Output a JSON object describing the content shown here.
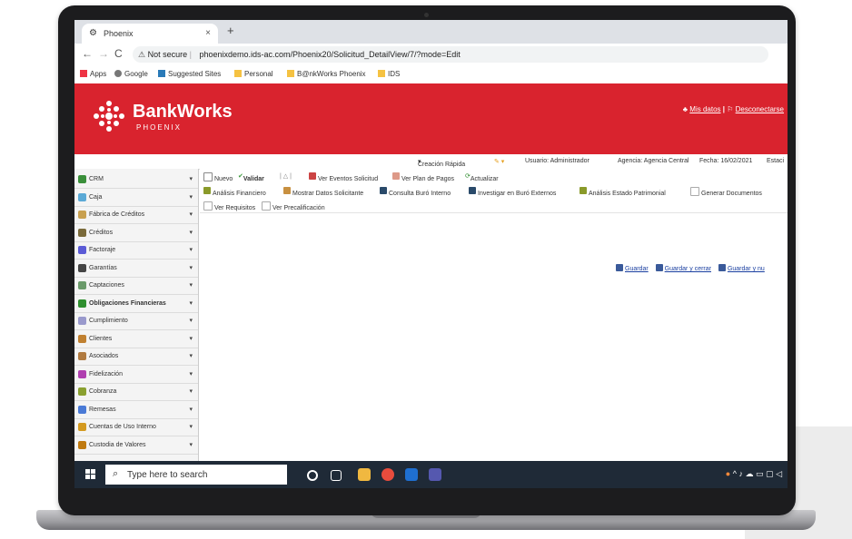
{
  "browser": {
    "tab_title": "Phoenix",
    "tab_close": "×",
    "new_tab": "+",
    "nav_back": "←",
    "nav_forward": "→",
    "nav_reload": "C",
    "security_label": "Not secure",
    "url": "phoenixdemo.ids-ac.com/Phoenix20/Solicitud_DetailView/7/?mode=Edit",
    "bookmarks": [
      "Apps",
      "Google",
      "Suggested Sites",
      "Personal",
      "B@nkWorks Phoenix",
      "IDS"
    ]
  },
  "app": {
    "brand": "BankWorks",
    "brand_sub": "PHOENIX",
    "header_links": [
      "Mis datos",
      "Desconectarse"
    ],
    "header_sep": "|",
    "info": {
      "quick_create": "Creación Rápida",
      "user": "Usuario: Administrador",
      "agency": "Agencia: Agencia Central",
      "date": "Fecha: 16/02/2021",
      "station": "Estaci"
    }
  },
  "sidebar": {
    "items": [
      {
        "label": "CRM",
        "color": "#3a8f3a"
      },
      {
        "label": "Caja",
        "color": "#5aa9d6"
      },
      {
        "label": "Fábrica de Créditos",
        "color": "#c8a050"
      },
      {
        "label": "Créditos",
        "color": "#7a6a3a"
      },
      {
        "label": "Factoraje",
        "color": "#5b5bd6"
      },
      {
        "label": "Garantías",
        "color": "#444444"
      },
      {
        "label": "Captaciones",
        "color": "#6a9a6a"
      },
      {
        "label": "Obligaciones Financieras",
        "color": "#2f8f2f"
      },
      {
        "label": "Cumplimiento",
        "color": "#9999cc"
      },
      {
        "label": "Clientes",
        "color": "#c08030"
      },
      {
        "label": "Asociados",
        "color": "#b07a40"
      },
      {
        "label": "Fidelización",
        "color": "#b040b0"
      },
      {
        "label": "Cobranza",
        "color": "#8aa030"
      },
      {
        "label": "Remesas",
        "color": "#4a7ad6"
      },
      {
        "label": "Cuentas de Uso Interno",
        "color": "#d49a20"
      },
      {
        "label": "Custodia de Valores",
        "color": "#c07a10"
      }
    ],
    "chevron": "▾"
  },
  "toolbar1": [
    "Nuevo",
    "Validar",
    "Ver Eventos Solicitud",
    "Ver Plan de Pagos",
    "Actualizar"
  ],
  "toolbar2": [
    "Análisis Financiero",
    "Mostrar Datos Solicitante",
    "Consulta Buró Interno",
    "Investigar en Buró Externos",
    "Análisis Estado Patrimonial",
    "Generar Documentos"
  ],
  "toolbar3": [
    "Ver Requisitos",
    "Ver Precalificación"
  ],
  "save_actions": [
    "Guardar",
    "Guardar y cerrar",
    "Guardar y nu"
  ],
  "taskbar": {
    "search_placeholder": "Type here to search"
  }
}
